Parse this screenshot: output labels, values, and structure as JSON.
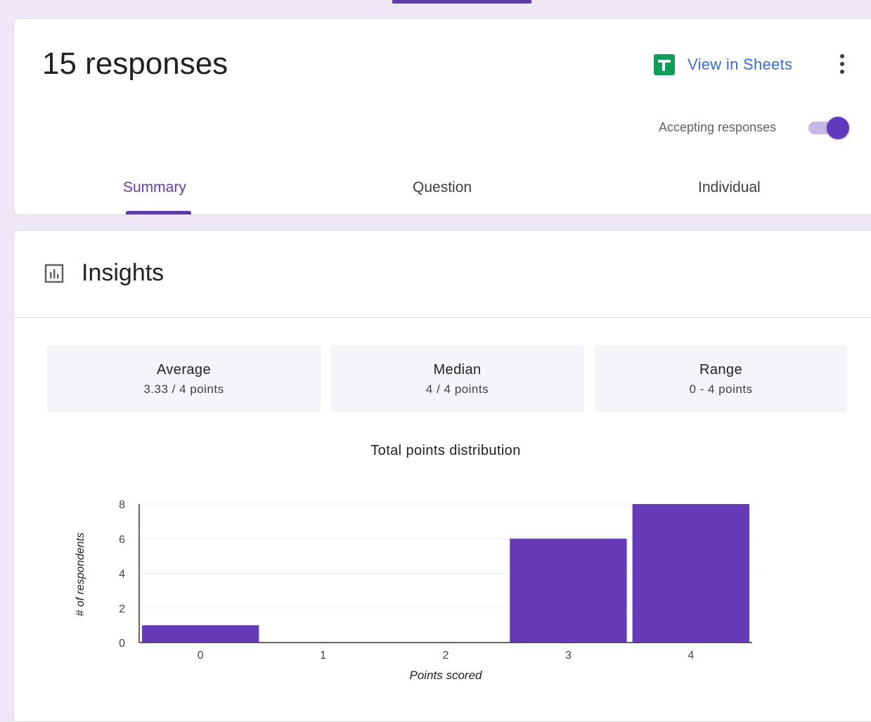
{
  "header": {
    "responses_title": "15 responses",
    "view_in_sheets_label": "View in Sheets",
    "accepting_label": "Accepting responses",
    "accepting_on": true
  },
  "tabs": [
    {
      "label": "Summary",
      "active": true
    },
    {
      "label": "Question",
      "active": false
    },
    {
      "label": "Individual",
      "active": false
    }
  ],
  "insights": {
    "title": "Insights",
    "stats": [
      {
        "label": "Average",
        "value": "3.33 / 4 points"
      },
      {
        "label": "Median",
        "value": "4 / 4 points"
      },
      {
        "label": "Range",
        "value": "0 - 4 points"
      }
    ]
  },
  "colors": {
    "accent": "#5b3ca8",
    "bar": "#673ab7",
    "link": "#3b6bd6",
    "sheets_green": "#0f9d58",
    "background": "#ede7f6"
  },
  "icons": {
    "sheets": "sheets-icon",
    "more": "more-vert-icon",
    "insights": "bar-chart-icon"
  },
  "chart_data": {
    "type": "bar",
    "title": "Total points distribution",
    "categories": [
      "0",
      "1",
      "2",
      "3",
      "4"
    ],
    "values": [
      1,
      0,
      0,
      6,
      8
    ],
    "xlabel": "Points scored",
    "ylabel": "# of respondents",
    "ylim": [
      0,
      8
    ],
    "yticks": [
      0,
      2,
      4,
      6,
      8
    ],
    "grid": true,
    "legend": "none"
  }
}
